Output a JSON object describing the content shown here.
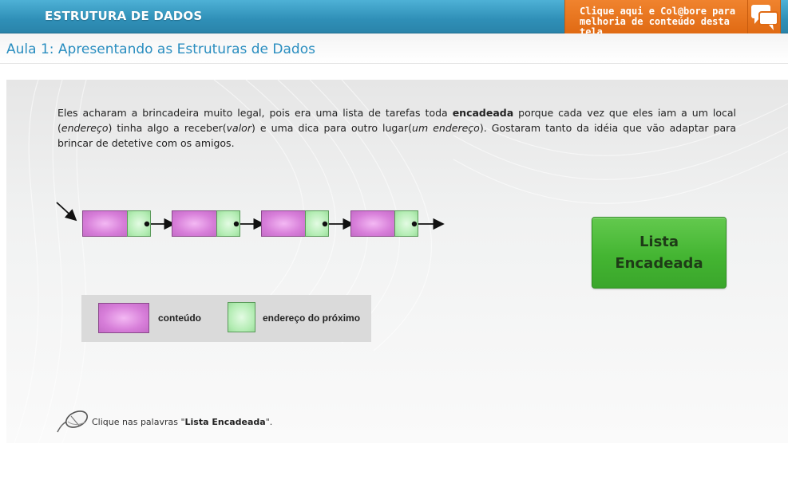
{
  "header": {
    "brand": "ESTRUTURA DE DADOS",
    "collab_text": "Clique aqui e Col@bore para melhoria de conteúdo desta tela",
    "collab_icon": "chat-bubbles-icon"
  },
  "page": {
    "title": "Aula 1: Apresentando as Estruturas de Dados"
  },
  "content": {
    "p1": "Eles acharam a brincadeira muito legal, pois era uma lista de tarefas toda ",
    "p1_bold": "encadeada",
    "p2": " porque cada vez que eles iam a um local (",
    "p2_italic": "endereço",
    "p3": ") tinha algo a receber(",
    "p3_italic": "valor",
    "p4": ") e uma dica para outro lugar(",
    "p4_italic": "um endereço",
    "p5": "). Gostaram tanto da idéia que vão adaptar para brincar de detetive com os amigos."
  },
  "diagram": {
    "node_count": 4,
    "colors": {
      "content": "#d77ed9",
      "address": "#b2ecb2"
    }
  },
  "legend": {
    "content_label": "conteúdo",
    "address_label": "endereço do próximo"
  },
  "button": {
    "label": "Lista\nEncadeada",
    "color": "#44b532"
  },
  "instruction": {
    "prefix": "Clique nas palavras \"",
    "bold": "Lista Encadeada",
    "suffix": "\".",
    "icon": "mouse-icon"
  }
}
